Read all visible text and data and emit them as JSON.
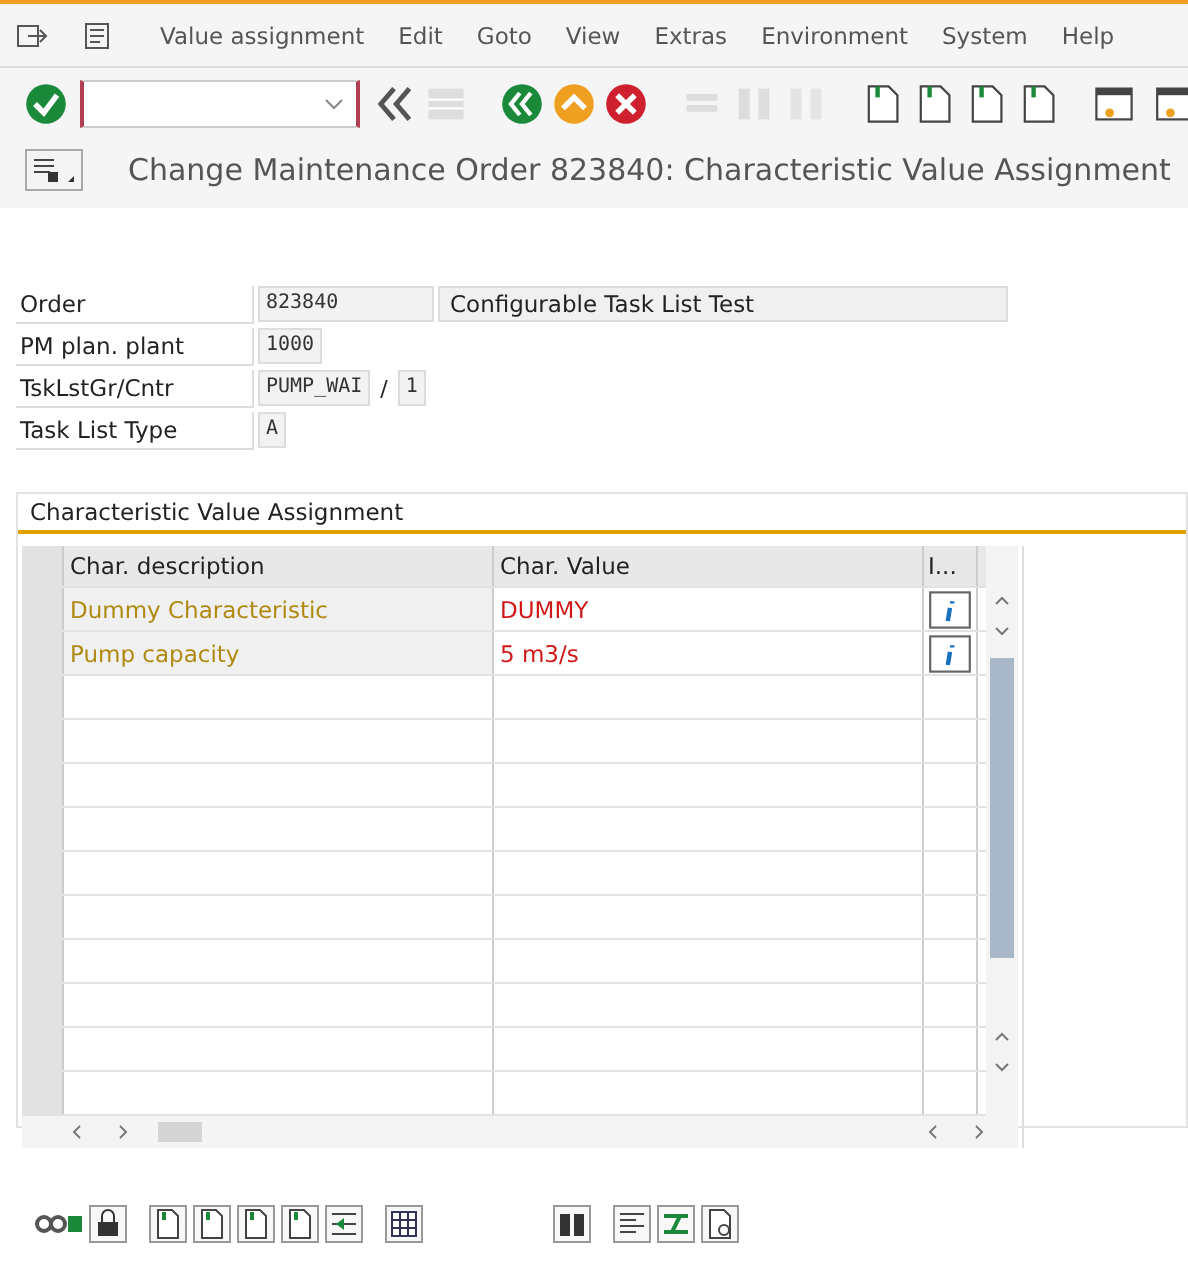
{
  "menu": [
    "Value assignment",
    "Edit",
    "Goto",
    "View",
    "Extras",
    "Environment",
    "System",
    "Help"
  ],
  "title": "Change Maintenance Order 823840: Characteristic Value Assignment",
  "fields": [
    {
      "label": "Order",
      "values": [
        "823840"
      ],
      "description": "Configurable Task List Test"
    },
    {
      "label": "PM plan. plant",
      "values": [
        "1000"
      ]
    },
    {
      "label": "TskLstGr/Cntr",
      "values": [
        "PUMP_WAI",
        "1"
      ],
      "separator": "/"
    },
    {
      "label": "Task List Type",
      "values": [
        "A"
      ]
    }
  ],
  "section": {
    "title": "Characteristic Value Assignment",
    "table": {
      "columns": [
        "Char. description",
        "Char. Value",
        "I..."
      ],
      "rows": [
        {
          "description": "Dummy Characteristic",
          "value": "DUMMY"
        },
        {
          "description": "Pump capacity",
          "value": "5 m3/s"
        }
      ]
    }
  }
}
